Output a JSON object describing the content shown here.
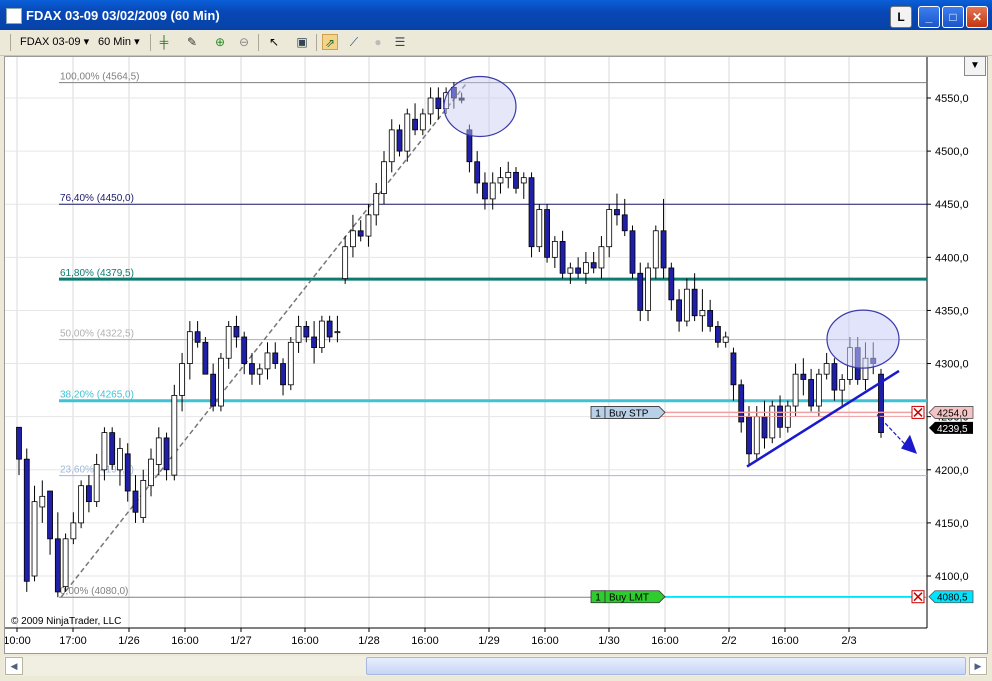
{
  "window": {
    "title": "FDAX 03-09  03/02/2009 (60 Min)",
    "btn_l": "L",
    "btn_min": "_",
    "btn_max": "□",
    "btn_close": "✕"
  },
  "toolbar": {
    "instrument": "FDAX 03-09",
    "interval": "60 Min",
    "icons": [
      "candlestick-icon",
      "pencil-icon",
      "zoom-in-icon",
      "zoom-out-icon",
      "cursor-icon",
      "properties-icon",
      "strategy-icon",
      "indicator-icon",
      "disabled-icon",
      "data-box-icon"
    ]
  },
  "chart_data": {
    "type": "candlestick",
    "title": "",
    "y_ticks": [
      "4550,0",
      "4500,0",
      "4450,0",
      "4400,0",
      "4350,0",
      "4300,0",
      "4250,0",
      "4200,0",
      "4150,0",
      "4100,0"
    ],
    "y_tick_values": [
      4550,
      4500,
      4450,
      4400,
      4350,
      4300,
      4250,
      4200,
      4150,
      4100
    ],
    "x_ticks": [
      "10:00",
      "17:00",
      "1/26",
      "16:00",
      "1/27",
      "16:00",
      "1/28",
      "16:00",
      "1/29",
      "16:00",
      "1/30",
      "16:00",
      "2/2",
      "16:00",
      "2/3"
    ],
    "ylim": [
      4060,
      4580
    ],
    "grid": true,
    "fib_levels": [
      {
        "label": "100,00% (4564,5)",
        "value": 4564.5,
        "color": "#808080"
      },
      {
        "label": "76,40% (4450,0)",
        "value": 4450.0,
        "color": "#1a1a6a"
      },
      {
        "label": "61,80% (4379,5)",
        "value": 4379.5,
        "color": "#0d7b6f"
      },
      {
        "label": "50,00% (4322,5)",
        "value": 4322.5,
        "color": "#b0b0b0"
      },
      {
        "label": "38,20% (4265,0)",
        "value": 4265.0,
        "color": "#3fc3d4"
      },
      {
        "label": "23,60% (4194,5)",
        "value": 4194.5,
        "color": "#a0b8d8"
      },
      {
        "label": "0,00% (4080,0)",
        "value": 4080.0,
        "color": "#808080"
      }
    ],
    "orders": [
      {
        "qty": "1",
        "type": "Buy STP",
        "price_label": "4254,0",
        "price": 4254.0
      },
      {
        "qty": "1",
        "type": "Buy LMT",
        "price_label": "4080,5",
        "price": 4080.5
      }
    ],
    "last_price_label": "4239,5",
    "last_price": 4239.5,
    "candles": [
      [
        4240,
        4240,
        4195,
        4210
      ],
      [
        4210,
        4220,
        4085,
        4095
      ],
      [
        4100,
        4185,
        4095,
        4170
      ],
      [
        4165,
        4190,
        4150,
        4175
      ],
      [
        4180,
        4180,
        4120,
        4135
      ],
      [
        4135,
        4160,
        4080,
        4085
      ],
      [
        4090,
        4140,
        4085,
        4135
      ],
      [
        4135,
        4160,
        4130,
        4150
      ],
      [
        4150,
        4190,
        4145,
        4185
      ],
      [
        4185,
        4195,
        4160,
        4170
      ],
      [
        4170,
        4215,
        4165,
        4205
      ],
      [
        4200,
        4240,
        4190,
        4235
      ],
      [
        4235,
        4240,
        4200,
        4205
      ],
      [
        4200,
        4230,
        4185,
        4220
      ],
      [
        4215,
        4225,
        4170,
        4180
      ],
      [
        4180,
        4195,
        4150,
        4160
      ],
      [
        4155,
        4200,
        4150,
        4190
      ],
      [
        4185,
        4220,
        4175,
        4210
      ],
      [
        4205,
        4240,
        4195,
        4230
      ],
      [
        4230,
        4235,
        4190,
        4200
      ],
      [
        4195,
        4280,
        4190,
        4270
      ],
      [
        4270,
        4310,
        4255,
        4300
      ],
      [
        4300,
        4340,
        4285,
        4330
      ],
      [
        4330,
        4340,
        4315,
        4320
      ],
      [
        4320,
        4325,
        4290,
        4290
      ],
      [
        4290,
        4300,
        4255,
        4260
      ],
      [
        4260,
        4310,
        4255,
        4305
      ],
      [
        4305,
        4340,
        4295,
        4335
      ],
      [
        4335,
        4345,
        4315,
        4325
      ],
      [
        4325,
        4330,
        4290,
        4300
      ],
      [
        4300,
        4310,
        4280,
        4290
      ],
      [
        4290,
        4300,
        4280,
        4295
      ],
      [
        4295,
        4320,
        4285,
        4310
      ],
      [
        4310,
        4320,
        4295,
        4300
      ],
      [
        4300,
        4305,
        4270,
        4280
      ],
      [
        4280,
        4325,
        4275,
        4320
      ],
      [
        4320,
        4345,
        4310,
        4335
      ],
      [
        4335,
        4340,
        4320,
        4325
      ],
      [
        4325,
        4340,
        4300,
        4315
      ],
      [
        4315,
        4345,
        4310,
        4340
      ],
      [
        4340,
        4345,
        4320,
        4325
      ],
      [
        4330,
        4345,
        4320,
        4330
      ],
      [
        4380,
        4420,
        4375,
        4410
      ],
      [
        4410,
        4440,
        4400,
        4425
      ],
      [
        4425,
        4435,
        4415,
        4420
      ],
      [
        4420,
        4450,
        4410,
        4440
      ],
      [
        4440,
        4470,
        4430,
        4460
      ],
      [
        4460,
        4500,
        4450,
        4490
      ],
      [
        4490,
        4530,
        4480,
        4520
      ],
      [
        4520,
        4525,
        4495,
        4500
      ],
      [
        4500,
        4540,
        4490,
        4535
      ],
      [
        4530,
        4545,
        4515,
        4520
      ],
      [
        4520,
        4540,
        4515,
        4535
      ],
      [
        4535,
        4560,
        4525,
        4550
      ],
      [
        4550,
        4560,
        4530,
        4540
      ],
      [
        4540,
        4560,
        4535,
        4555
      ],
      [
        4560,
        4565,
        4540,
        4550
      ],
      [
        4550,
        4555,
        4545,
        4548
      ],
      [
        4520,
        4525,
        4480,
        4490
      ],
      [
        4490,
        4500,
        4460,
        4470
      ],
      [
        4470,
        4480,
        4445,
        4455
      ],
      [
        4455,
        4480,
        4445,
        4470
      ],
      [
        4470,
        4485,
        4460,
        4475
      ],
      [
        4475,
        4490,
        4465,
        4480
      ],
      [
        4480,
        4485,
        4460,
        4465
      ],
      [
        4470,
        4480,
        4455,
        4475
      ],
      [
        4475,
        4480,
        4400,
        4410
      ],
      [
        4410,
        4450,
        4405,
        4445
      ],
      [
        4445,
        4450,
        4395,
        4400
      ],
      [
        4400,
        4420,
        4390,
        4415
      ],
      [
        4415,
        4425,
        4380,
        4385
      ],
      [
        4385,
        4395,
        4375,
        4390
      ],
      [
        4390,
        4400,
        4380,
        4385
      ],
      [
        4385,
        4405,
        4375,
        4395
      ],
      [
        4395,
        4405,
        4385,
        4390
      ],
      [
        4390,
        4420,
        4380,
        4410
      ],
      [
        4410,
        4450,
        4400,
        4445
      ],
      [
        4445,
        4460,
        4430,
        4440
      ],
      [
        4440,
        4455,
        4420,
        4425
      ],
      [
        4425,
        4430,
        4380,
        4385
      ],
      [
        4385,
        4395,
        4340,
        4350
      ],
      [
        4350,
        4395,
        4340,
        4390
      ],
      [
        4390,
        4430,
        4380,
        4425
      ],
      [
        4425,
        4455,
        4380,
        4390
      ],
      [
        4390,
        4395,
        4350,
        4360
      ],
      [
        4360,
        4370,
        4330,
        4340
      ],
      [
        4340,
        4380,
        4335,
        4370
      ],
      [
        4370,
        4385,
        4340,
        4345
      ],
      [
        4345,
        4370,
        4330,
        4350
      ],
      [
        4350,
        4360,
        4330,
        4335
      ],
      [
        4335,
        4340,
        4315,
        4320
      ],
      [
        4320,
        4330,
        4315,
        4325
      ],
      [
        4310,
        4315,
        4265,
        4280
      ],
      [
        4280,
        4285,
        4235,
        4245
      ],
      [
        4250,
        4260,
        4205,
        4215
      ],
      [
        4215,
        4260,
        4210,
        4250
      ],
      [
        4250,
        4265,
        4220,
        4230
      ],
      [
        4230,
        4265,
        4225,
        4260
      ],
      [
        4260,
        4270,
        4230,
        4240
      ],
      [
        4240,
        4265,
        4235,
        4260
      ],
      [
        4260,
        4300,
        4250,
        4290
      ],
      [
        4290,
        4305,
        4270,
        4285
      ],
      [
        4285,
        4295,
        4255,
        4260
      ],
      [
        4260,
        4295,
        4250,
        4290
      ],
      [
        4290,
        4310,
        4285,
        4300
      ],
      [
        4300,
        4305,
        4265,
        4275
      ],
      [
        4275,
        4290,
        4260,
        4285
      ],
      [
        4285,
        4325,
        4280,
        4315
      ],
      [
        4315,
        4325,
        4280,
        4285
      ],
      [
        4285,
        4320,
        4275,
        4305
      ],
      [
        4305,
        4320,
        4290,
        4300
      ],
      [
        4290,
        4295,
        4230,
        4235
      ]
    ]
  },
  "copyright": "© 2009 NinjaTrader, LLC"
}
